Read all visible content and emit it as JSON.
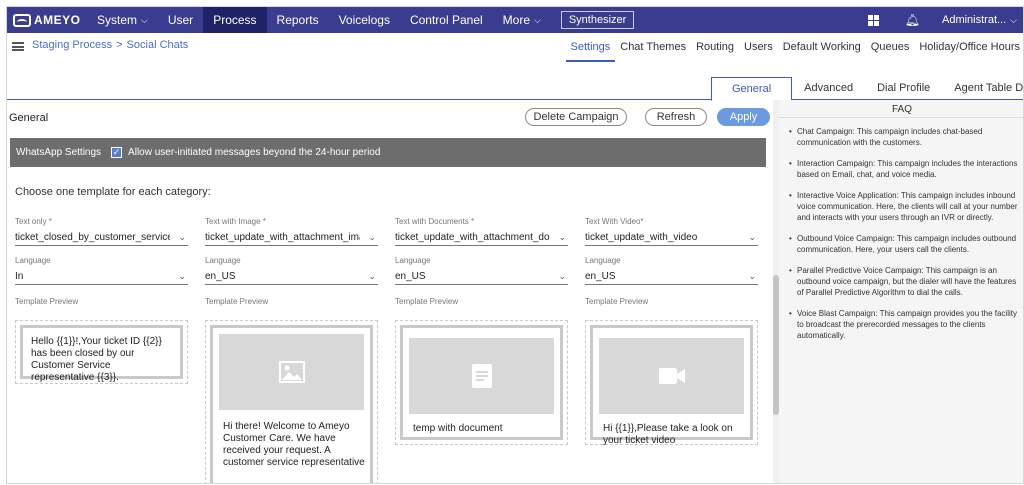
{
  "brand": "AMEYO",
  "nav": {
    "items": [
      "System",
      "User",
      "Process",
      "Reports",
      "Voicelogs",
      "Control Panel",
      "More"
    ],
    "synthesizer": "Synthesizer",
    "user": "Administrat..."
  },
  "breadcrumb": {
    "root": "Staging Process",
    "current": "Social Chats"
  },
  "subtabs": [
    "Settings",
    "Chat Themes",
    "Routing",
    "Users",
    "Default Working",
    "Queues",
    "Holiday/Office Hours"
  ],
  "maintabs": [
    "General",
    "Advanced",
    "Dial Profile",
    "Agent Table Definition"
  ],
  "general": {
    "title": "General",
    "delete_label": "Delete Campaign",
    "refresh_label": "Refresh",
    "apply_label": "Apply",
    "whatsapp_label": "WhatsApp Settings",
    "checkbox_label": "Allow user-initiated messages beyond the 24-hour period",
    "checkbox_checked": true,
    "choose_text": "Choose one template for each category:",
    "language_label": "Language",
    "preview_label": "Template Preview",
    "columns": [
      {
        "label": "Text only *",
        "value": "ticket_closed_by_customer_service_rep",
        "language": "In",
        "preview": "Hello {{1}}!,Your ticket ID {{2}} has been closed by our Customer Service representative {{3}}."
      },
      {
        "label": "Text with Image *",
        "value": "ticket_update_with_attachment_image_",
        "language": "en_US",
        "preview": "Hi there! Welcome to Ameyo Customer Care. We have received your request. A customer service representative"
      },
      {
        "label": "Text with Documents *",
        "value": "ticket_update_with_attachment_docume",
        "language": "en_US",
        "preview": "temp with document"
      },
      {
        "label": "Text With Video*",
        "value": "ticket_update_with_video",
        "language": "en_US",
        "preview": "Hi {{1}},Please take a look on your ticket video"
      }
    ]
  },
  "faq": {
    "title": "FAQ",
    "items": [
      "Chat Campaign: This campaign includes chat-based communication with the customers.",
      "Interaction Campaign: This campaign includes the interactions based on Email, chat, and voice media.",
      "Interactive Voice Application: This campaign includes inbound voice communication. Here, the clients will call at your number and interacts with your users through an IVR or directly.",
      "Outbound Voice Campaign: This campaign includes outbound communication. Here, your users call the clients.",
      "Parallel Predictive Voice Campaign: This campaign is an outbound voice campaign, but the dialer will have the features of Parallel Predictive Algorithm to dial the calls.",
      "Voice Blast Campaign: This campaign provides you the facility to broadcast the prerecorded messages to the clients automatically."
    ]
  },
  "colors": {
    "nav_bg": "#3a3d8f",
    "nav_active": "#1f2266",
    "accent": "#3a5bbf",
    "apply": "#6c9ae0",
    "wa_bar": "#6d6d6d"
  },
  "icons": [
    "grid-icon",
    "bell-icon",
    "image-icon",
    "document-icon",
    "video-icon",
    "hamburger-icon",
    "chevron-down-icon"
  ]
}
